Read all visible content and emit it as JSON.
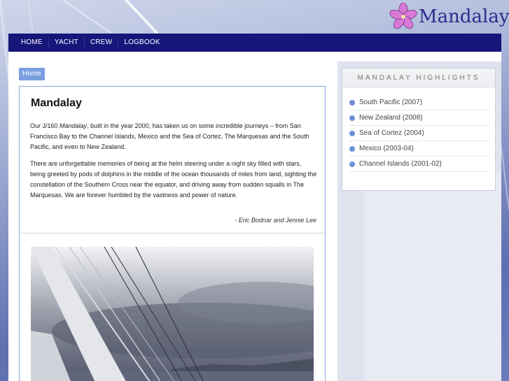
{
  "brand": {
    "name": "Mandalay",
    "icon": "hibiscus-flower-icon"
  },
  "nav": {
    "items": [
      "HOME",
      "YACHT",
      "CREW",
      "LOGBOOK"
    ]
  },
  "breadcrumb": {
    "label": "Home"
  },
  "article": {
    "title": "Mandalay",
    "para1_prefix": "Our J/160 ",
    "para1_em": "Mandalay",
    "para1_suffix": ", built in the year 2000, has taken us on some incredible journeys – from San Francisco Bay to the Channel Islands, Mexico and the Sea of Cortez, The Marquesas and the South Pacific, and even to New Zealand.",
    "para2": "There are unforgettable memories of being at the helm steering under a night sky filled with stars, being greeted by pods of dolphins in the middle of the ocean thousands of miles from land, sighting the constellation of the Southern Cross near the equator, and driving away from sudden squalls in The Marquesas. We are forever humbled by the vastness and power of nature.",
    "signature": "- Eric Bodnar and Jennie Lee"
  },
  "highlights": {
    "title": "MANDALAY HIGHLIGHTS",
    "items": [
      "South Pacific (2007)",
      "New Zealand (2008)",
      "Sea of Cortez (2004)",
      "Mexico (2003-04)",
      "Channel Islands (2001-02)"
    ]
  },
  "colors": {
    "nav_bg": "#15157a",
    "accent": "#7a9fe0",
    "bullet": "#6e8fd8",
    "logo_text": "#2c2c8c",
    "flower": "#c85fc8"
  }
}
